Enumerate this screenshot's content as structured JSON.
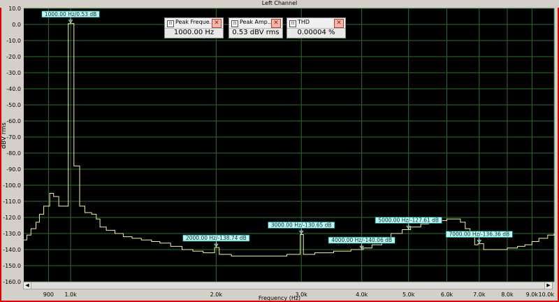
{
  "window": {
    "title": "Left Channel"
  },
  "meters": [
    {
      "title": "Peak Freque...",
      "value": "1000.00 Hz"
    },
    {
      "title": "Peak Amp...",
      "value": "0.53 dBV rms"
    },
    {
      "title": "THD",
      "value": "0.00004  %"
    }
  ],
  "icons": {
    "meter": "meter-icon",
    "close": "close-icon",
    "scroll_left": "arrow-left-icon",
    "scroll_right": "arrow-right-icon"
  },
  "scroll_glyphs": {
    "left": "◀",
    "right": "▶"
  },
  "meter_glyphs": {
    "icon": "⊡",
    "close": "✕"
  },
  "colors": {
    "plot_background": "#000000",
    "grid": "#2f6b2f",
    "trace": "#f0f0a8",
    "annotation_fill": "#bff7f0",
    "annotation_border": "#007777",
    "window_border": "#e00000"
  },
  "chart_data": {
    "type": "line",
    "title": "Left Channel",
    "xlabel": "Frequency (Hz)",
    "ylabel": "dBV rms",
    "x_scale": "log",
    "xlim": [
      800,
      10000
    ],
    "ylim": [
      -160,
      10
    ],
    "grid": true,
    "x_ticks": [
      {
        "value": 900,
        "label": "900"
      },
      {
        "value": 1000,
        "label": "1.0k"
      },
      {
        "value": 2000,
        "label": "2.0k"
      },
      {
        "value": 3000,
        "label": "3.0k"
      },
      {
        "value": 4000,
        "label": "4.0k"
      },
      {
        "value": 5000,
        "label": "5.0k"
      },
      {
        "value": 6000,
        "label": "6.0k"
      },
      {
        "value": 7000,
        "label": "7.0k"
      },
      {
        "value": 8000,
        "label": "8.0k"
      },
      {
        "value": 9000,
        "label": "9.0k"
      },
      {
        "value": 10000,
        "label": "10.0k"
      }
    ],
    "y_ticks": [
      {
        "value": 10,
        "label": "10.0"
      },
      {
        "value": 0,
        "label": "0.0"
      },
      {
        "value": -10,
        "label": "-10.0"
      },
      {
        "value": -20,
        "label": "-20.0"
      },
      {
        "value": -30,
        "label": "-30.0"
      },
      {
        "value": -40,
        "label": "-40.0"
      },
      {
        "value": -50,
        "label": "-50.0"
      },
      {
        "value": -60,
        "label": "-60.0"
      },
      {
        "value": -70,
        "label": "-70.0"
      },
      {
        "value": -80,
        "label": "-80.0"
      },
      {
        "value": -90,
        "label": "-90.0"
      },
      {
        "value": -100,
        "label": "-100.0"
      },
      {
        "value": -110,
        "label": "-110.0"
      },
      {
        "value": -120,
        "label": "-120.0"
      },
      {
        "value": -130,
        "label": "-130.0"
      },
      {
        "value": -140,
        "label": "-140.0"
      },
      {
        "value": -150,
        "label": "-150.0"
      },
      {
        "value": -160,
        "label": "-160.0"
      }
    ],
    "series": [
      {
        "points": [
          [
            800,
            -134
          ],
          [
            812,
            -131
          ],
          [
            828,
            -127
          ],
          [
            848,
            -123
          ],
          [
            862,
            -118
          ],
          [
            880,
            -113
          ],
          [
            905,
            -105
          ],
          [
            922,
            -107
          ],
          [
            945,
            -113
          ],
          [
            985,
            -113
          ],
          [
            989,
            0.53
          ],
          [
            1010,
            0.53
          ],
          [
            1016,
            -88
          ],
          [
            1038,
            -88
          ],
          [
            1044,
            -113
          ],
          [
            1070,
            -117
          ],
          [
            1105,
            -118
          ],
          [
            1130,
            -121
          ],
          [
            1150,
            -126
          ],
          [
            1185,
            -128
          ],
          [
            1235,
            -130
          ],
          [
            1285,
            -132
          ],
          [
            1340,
            -133
          ],
          [
            1400,
            -134
          ],
          [
            1470,
            -135
          ],
          [
            1530,
            -136
          ],
          [
            1610,
            -138
          ],
          [
            1700,
            -140
          ],
          [
            1790,
            -141
          ],
          [
            1880,
            -142
          ],
          [
            1960,
            -142
          ],
          [
            1985,
            -138.74
          ],
          [
            2012,
            -138.74
          ],
          [
            2030,
            -143
          ],
          [
            2150,
            -144
          ],
          [
            2400,
            -144
          ],
          [
            2600,
            -144
          ],
          [
            2800,
            -143
          ],
          [
            2975,
            -143
          ],
          [
            2985,
            -130.65
          ],
          [
            3022,
            -130.65
          ],
          [
            3030,
            -143
          ],
          [
            3200,
            -142
          ],
          [
            3500,
            -141
          ],
          [
            3800,
            -140
          ],
          [
            3970,
            -140
          ],
          [
            3985,
            -140.06
          ],
          [
            4018,
            -140.06
          ],
          [
            4030,
            -139
          ],
          [
            4200,
            -137
          ],
          [
            4400,
            -133
          ],
          [
            4600,
            -130
          ],
          [
            4850,
            -127.61
          ],
          [
            5050,
            -126
          ],
          [
            5300,
            -124
          ],
          [
            5500,
            -123
          ],
          [
            5750,
            -122
          ],
          [
            6000,
            -121
          ],
          [
            6250,
            -121
          ],
          [
            6400,
            -123
          ],
          [
            6550,
            -127
          ],
          [
            6700,
            -131
          ],
          [
            6850,
            -137
          ],
          [
            6960,
            -136.36
          ],
          [
            7040,
            -136.36
          ],
          [
            7150,
            -140
          ],
          [
            7400,
            -140
          ],
          [
            7700,
            -140
          ],
          [
            8000,
            -139
          ],
          [
            8400,
            -138
          ],
          [
            8700,
            -137
          ],
          [
            9000,
            -135
          ],
          [
            9300,
            -133
          ],
          [
            9700,
            -131
          ],
          [
            10000,
            -130
          ]
        ]
      }
    ],
    "annotations": [
      {
        "x": 1000,
        "y": 0.53,
        "label": "1000.00 Hz/0.53 dB"
      },
      {
        "x": 2000,
        "y": -138.74,
        "label": "2000.00 Hz/-138.74 dB"
      },
      {
        "x": 3000,
        "y": -130.65,
        "label": "3000.00 Hz/-130.65 dB"
      },
      {
        "x": 4000,
        "y": -140.06,
        "label": "4000.00 Hz/-140.06 dB"
      },
      {
        "x": 5000,
        "y": -127.61,
        "label": "5000.00 Hz/-127.61 dB"
      },
      {
        "x": 7000,
        "y": -136.36,
        "label": "7000.00 Hz/-136.36 dB"
      }
    ]
  }
}
